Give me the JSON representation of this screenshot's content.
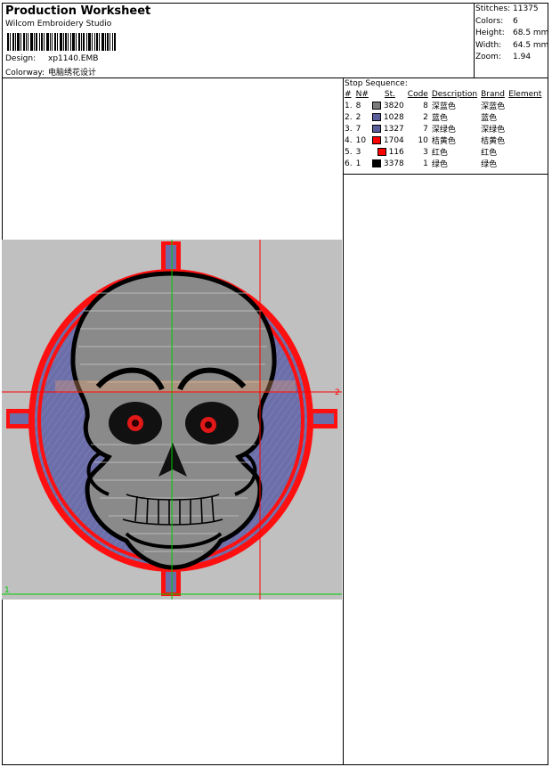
{
  "header": {
    "title": "Production Worksheet",
    "app_name": "Wilcom  Embroidery Studio",
    "design_label": "Design:",
    "design_value": "xp1140.EMB",
    "colorway_label": "Colorway:",
    "colorway_value": "电脑绣花设计"
  },
  "stats": [
    {
      "label": "Stitches:",
      "value": "11375"
    },
    {
      "label": "Colors:",
      "value": "6"
    },
    {
      "label": "Height:",
      "value": "68.5 mm"
    },
    {
      "label": "Width:",
      "value": "64.5 mm"
    },
    {
      "label": "Zoom:",
      "value": "1.94"
    }
  ],
  "stop_sequence": {
    "title": "Stop Sequence:",
    "headers": [
      "#",
      "N#",
      "St.",
      "Code",
      "Description",
      "Brand",
      "Element"
    ],
    "rows": [
      {
        "index": "1.",
        "n": "8",
        "st": "3820",
        "code": "8",
        "description": "深蓝色",
        "brand": "深蓝色",
        "element": "",
        "color": "#7a7a7a"
      },
      {
        "index": "2.",
        "n": "2",
        "st": "1028",
        "code": "2",
        "description": "蓝色",
        "brand": "蓝色",
        "element": "",
        "color": "#5a5f9c"
      },
      {
        "index": "3.",
        "n": "7",
        "st": "1327",
        "code": "7",
        "description": "深绿色",
        "brand": "深绿色",
        "element": "",
        "color": "#5a5f9c"
      },
      {
        "index": "4.",
        "n": "10",
        "st": "1704",
        "code": "10",
        "description": "桔黄色",
        "brand": "桔黄色",
        "element": "",
        "color": "#ff0000"
      },
      {
        "index": "5.",
        "n": "3",
        "st": "116",
        "code": "3",
        "description": "红色",
        "brand": "红色",
        "element": "",
        "color": "#ff0000"
      },
      {
        "index": "6.",
        "n": "1",
        "st": "3378",
        "code": "1",
        "description": "绿色",
        "brand": "绿色",
        "element": "",
        "color": "#000000"
      }
    ]
  },
  "design_preview": {
    "marker_x_label": "2",
    "marker_y_label": "1",
    "colors": {
      "background": "#c0c0c0",
      "ring_red": "#ff1010",
      "ring_blue": "#6b6ea8",
      "skull_fill": "#8a8a8a",
      "outline": "#000000",
      "guide_green": "#00cc00",
      "guide_red": "#ff0000"
    }
  }
}
